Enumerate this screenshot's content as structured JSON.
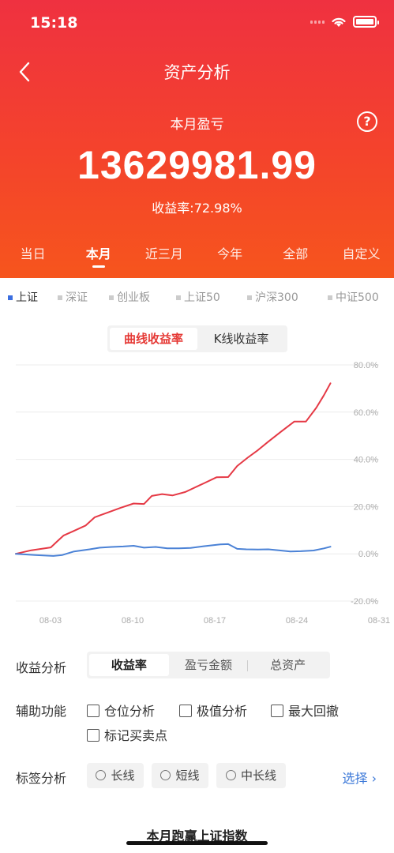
{
  "status": {
    "time": "15:18"
  },
  "header": {
    "title": "资产分析",
    "month_label": "本月盈亏",
    "amount": "13629981.99",
    "rate_text": "收益率:72.98%",
    "help_glyph": "?"
  },
  "period_tabs": [
    "当日",
    "本月",
    "近三月",
    "今年",
    "全部",
    "自定义"
  ],
  "period_active": 1,
  "index_tabs": [
    "上证",
    "深证",
    "创业板",
    "上证50",
    "沪深300",
    "中证500"
  ],
  "index_active": 0,
  "chart_toggle": {
    "curve": "曲线收益率",
    "kline": "K线收益率"
  },
  "chart_data": {
    "type": "line",
    "x_ticks": [
      "08-03",
      "08-10",
      "08-17",
      "08-24",
      "08-31"
    ],
    "y_ticks": [
      "80.0%",
      "60.0%",
      "40.0%",
      "20.0%",
      "0.0%",
      "-20.0%"
    ],
    "ylim": [
      -20,
      80
    ],
    "y_unit": "%",
    "grid": true,
    "series": [
      {
        "color": "#e53945",
        "points": [
          [
            0,
            0
          ],
          [
            1.2,
            1.5
          ],
          [
            2.7,
            2.7
          ],
          [
            3.2,
            5.3
          ],
          [
            3.7,
            7.8
          ],
          [
            4.4,
            9.5
          ],
          [
            5.4,
            12
          ],
          [
            6.1,
            15.5
          ],
          [
            7.1,
            17.5
          ],
          [
            8.1,
            19.5
          ],
          [
            9.1,
            21.3
          ],
          [
            9.9,
            21.1
          ],
          [
            10.5,
            24.5
          ],
          [
            11.3,
            25.3
          ],
          [
            12.1,
            24.7
          ],
          [
            13.1,
            26.2
          ],
          [
            14.5,
            29.8
          ],
          [
            15.5,
            32.4
          ],
          [
            16.4,
            32.5
          ],
          [
            17.1,
            37.2
          ],
          [
            17.9,
            40.7
          ],
          [
            18.7,
            43.9
          ],
          [
            19.5,
            47.5
          ],
          [
            20.5,
            51.8
          ],
          [
            21.5,
            56
          ],
          [
            22.4,
            56
          ],
          [
            23.2,
            61.8
          ],
          [
            23.8,
            67.2
          ],
          [
            24.3,
            72.2
          ]
        ]
      },
      {
        "color": "#4b82d6",
        "points": [
          [
            0,
            0
          ],
          [
            1.5,
            -0.5
          ],
          [
            2.9,
            -0.9
          ],
          [
            3.6,
            -0.5
          ],
          [
            4.5,
            1
          ],
          [
            5.7,
            1.9
          ],
          [
            6.5,
            2.6
          ],
          [
            7.4,
            2.9
          ],
          [
            8.3,
            3.1
          ],
          [
            9.1,
            3.4
          ],
          [
            9.9,
            2.6
          ],
          [
            10.8,
            2.9
          ],
          [
            11.7,
            2.3
          ],
          [
            12.6,
            2.3
          ],
          [
            13.5,
            2.5
          ],
          [
            14.5,
            3.2
          ],
          [
            15.8,
            4
          ],
          [
            16.4,
            4.1
          ],
          [
            17.1,
            2.1
          ],
          [
            17.8,
            1.9
          ],
          [
            18.7,
            1.8
          ],
          [
            19.5,
            1.9
          ],
          [
            20.3,
            1.5
          ],
          [
            21.2,
            1
          ],
          [
            22,
            1.1
          ],
          [
            23,
            1.4
          ],
          [
            23.8,
            2.3
          ],
          [
            24.3,
            3
          ]
        ]
      }
    ]
  },
  "analysis": {
    "label": "收益分析",
    "options": [
      "收益率",
      "盈亏金额",
      "总资产"
    ],
    "active": 0
  },
  "aux": {
    "label": "辅助功能",
    "checks": [
      "仓位分析",
      "极值分析",
      "最大回撤",
      "标记买卖点"
    ]
  },
  "tags": {
    "label": "标签分析",
    "options": [
      "长线",
      "短线",
      "中长线"
    ],
    "select": "选择"
  },
  "bottom": {
    "title": "本月跑赢上证指数"
  }
}
